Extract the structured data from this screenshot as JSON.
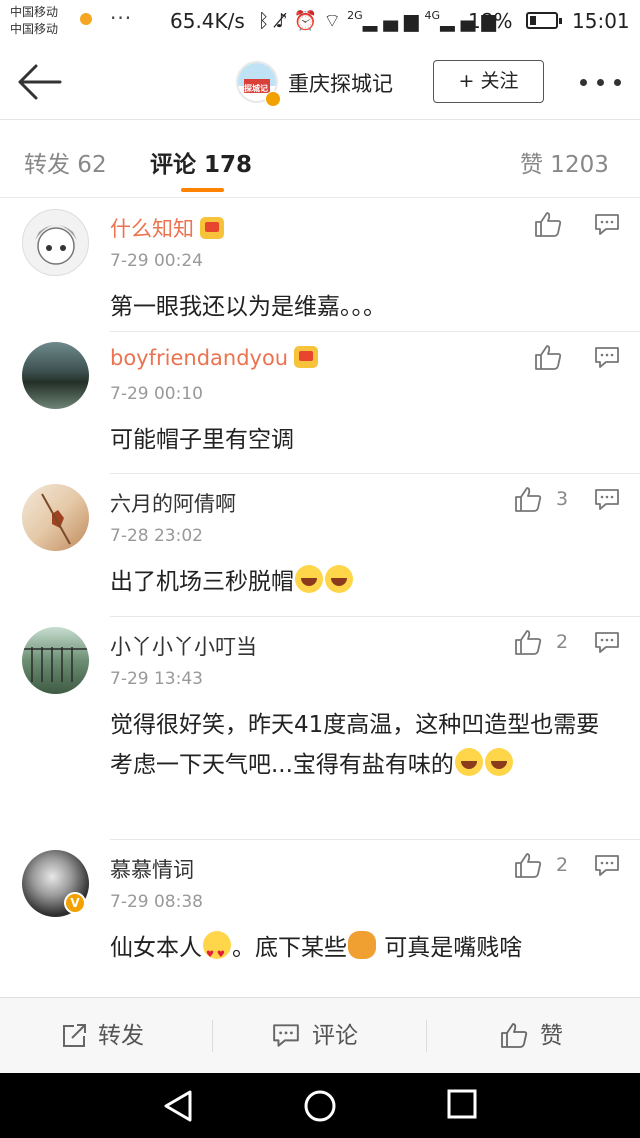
{
  "status_bar": {
    "carrier1": "中国移动",
    "carrier2": "中国移动",
    "more": "···",
    "speed": "65.4K/s",
    "signal_2g": "2G",
    "signal_4g": "4G",
    "battery_pct": "18%",
    "time": "15:01"
  },
  "nav": {
    "account_name": "重庆探城记",
    "account_logo_text": "探城记",
    "follow_label": "+ 关注"
  },
  "tabs": {
    "repost": "转发 62",
    "comment": "评论 178",
    "likes": "赞 1203"
  },
  "comments": [
    {
      "user": "什么知知",
      "time": "7-29 00:24",
      "text": "第一眼我还以为是维嘉。。。",
      "likes": ""
    },
    {
      "user": "boyfriendandyou",
      "time": "7-29 00:10",
      "text": "可能帽子里有空调",
      "likes": ""
    },
    {
      "user": "六月的阿倩啊",
      "time": "7-28 23:02",
      "text": "出了机场三秒脱帽",
      "likes": "3"
    },
    {
      "user": "小丫小丫小叮当",
      "time": "7-29 13:43",
      "text": "觉得很好笑，昨天41度高温，这种凹造型也需要考虑一下天气吧...宝得有盐有味的",
      "likes": "2"
    },
    {
      "user": "慕慕情词",
      "time": "7-29 08:38",
      "text_a": "仙女本人",
      "text_b": "。底下某些",
      "text_c": " 可真是嘴贱啥",
      "likes": "2"
    }
  ],
  "bottom_bar": {
    "repost": "转发",
    "comment": "评论",
    "like": "赞"
  },
  "colors": {
    "accent": "#ff8200",
    "vip_name": "#eb7350",
    "verified": "#f2a100"
  }
}
